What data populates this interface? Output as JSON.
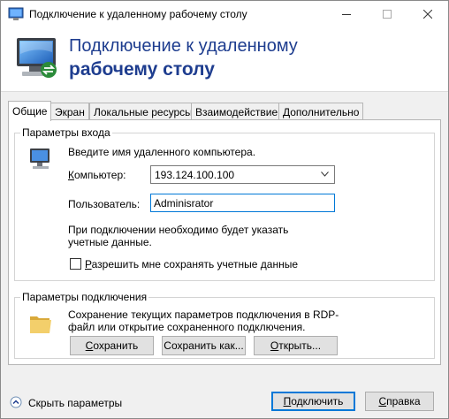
{
  "window": {
    "title": "Подключение к удаленному рабочему столу"
  },
  "header": {
    "line1": "Подключение к удаленному",
    "line2": "рабочему столу"
  },
  "tabs": [
    {
      "label": "Общие",
      "active": true
    },
    {
      "label": "Экран",
      "active": false
    },
    {
      "label": "Локальные ресурсы",
      "active": false
    },
    {
      "label": "Взаимодействие",
      "active": false
    },
    {
      "label": "Дополнительно",
      "active": false
    }
  ],
  "login": {
    "group_title": "Параметры входа",
    "prompt": "Введите имя удаленного компьютера.",
    "computer_label_ul": "К",
    "computer_label_rest": "омпьютер:",
    "computer_value": "193.124.100.100",
    "user_label": "Пользователь:",
    "user_value": "Adminisrator",
    "credentials_note": "При подключении необходимо будет указать учетные данные.",
    "save_creds_ul": "Р",
    "save_creds_rest": "азрешить мне сохранять учетные данные",
    "save_creds_checked": false
  },
  "connection": {
    "group_title": "Параметры подключения",
    "description": "Сохранение текущих параметров подключения в RDP-файл или открытие сохраненного подключения.",
    "save_button_ul": "С",
    "save_button_rest": "охранить",
    "save_as_button": "Сохранить как...",
    "open_button_pre": "",
    "open_button_ul": "О",
    "open_button_rest": "ткрыть..."
  },
  "footer": {
    "toggle_label": "Скрыть параметры",
    "connect_button_ul": "П",
    "connect_button_rest": "одключить",
    "help_button_ul": "С",
    "help_button_rest": "правка"
  },
  "colors": {
    "header_text": "#1e3d8f",
    "focus_border": "#0078d7"
  },
  "icons": [
    "rdp-app-icon",
    "rdp-large-icon",
    "computer-icon",
    "folder-icon",
    "collapse-arrow-icon",
    "minimize-icon",
    "maximize-icon",
    "close-icon"
  ]
}
